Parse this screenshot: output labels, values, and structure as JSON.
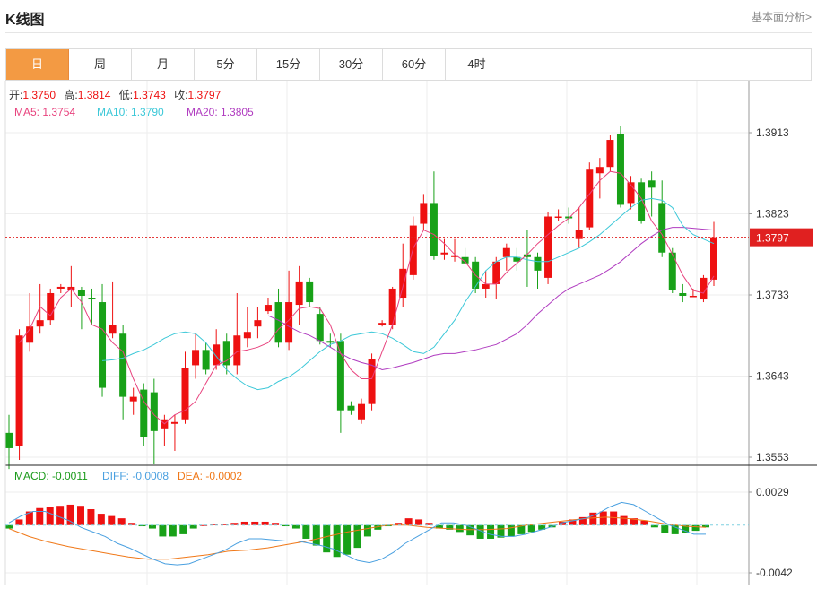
{
  "header": {
    "title": "K线图",
    "link": "基本面分析>"
  },
  "tabs": [
    "日",
    "周",
    "月",
    "5分",
    "15分",
    "30分",
    "60分",
    "4时"
  ],
  "active_tab": 0,
  "colors": {
    "up": "#ee1111",
    "down": "#18a118",
    "ma5": "#e8437e",
    "ma10": "#3cc8d8",
    "ma20": "#b03cc0",
    "macd": "#1a9a1a",
    "diff": "#4aa0e0",
    "dea": "#f07818",
    "price_line": "#e02020"
  },
  "chart_data": [
    {
      "type": "candlestick",
      "ohlc_labels": {
        "open_label": "开:",
        "open": "1.3750",
        "high_label": "高:",
        "high": "1.3814",
        "low_label": "低:",
        "low": "1.3743",
        "close_label": "收:",
        "close": "1.3797"
      },
      "ma_labels": {
        "ma5": "MA5: 1.3754",
        "ma10": "MA10: 1.3790",
        "ma20": "MA20: 1.3805"
      },
      "y_ticks": [
        "1.3913",
        "1.3823",
        "1.3733",
        "1.3643",
        "1.3553"
      ],
      "last_price": "1.3797",
      "ylim": [
        1.3553,
        1.3913
      ],
      "candles": [
        [
          1.358,
          1.3563,
          1.36,
          1.354
        ],
        [
          1.3565,
          1.3688,
          1.3695,
          1.355
        ],
        [
          1.368,
          1.3698,
          1.3735,
          1.367
        ],
        [
          1.3698,
          1.3705,
          1.3745,
          1.369
        ],
        [
          1.3705,
          1.3735,
          1.374,
          1.37
        ],
        [
          1.374,
          1.3742,
          1.3745,
          1.3735
        ],
        [
          1.3738,
          1.3742,
          1.3765,
          1.372
        ],
        [
          1.3738,
          1.3732,
          1.3742,
          1.3695
        ],
        [
          1.373,
          1.3728,
          1.374,
          1.37
        ],
        [
          1.3725,
          1.363,
          1.3745,
          1.362
        ],
        [
          1.369,
          1.37,
          1.3748,
          1.3685
        ],
        [
          1.369,
          1.362,
          1.37,
          1.3595
        ],
        [
          1.3615,
          1.362,
          1.363,
          1.36
        ],
        [
          1.3628,
          1.3575,
          1.3635,
          1.3565
        ],
        [
          1.3625,
          1.3582,
          1.364,
          1.3545
        ],
        [
          1.3585,
          1.3595,
          1.36,
          1.3565
        ],
        [
          1.359,
          1.3592,
          1.36,
          1.356
        ],
        [
          1.3595,
          1.3652,
          1.367,
          1.359
        ],
        [
          1.3655,
          1.3672,
          1.369,
          1.364
        ],
        [
          1.3672,
          1.365,
          1.368,
          1.3645
        ],
        [
          1.3655,
          1.3678,
          1.3695,
          1.365
        ],
        [
          1.3682,
          1.3655,
          1.369,
          1.3645
        ],
        [
          1.3655,
          1.3688,
          1.3735,
          1.3645
        ],
        [
          1.3685,
          1.3692,
          1.372,
          1.3675
        ],
        [
          1.3698,
          1.3705,
          1.372,
          1.3685
        ],
        [
          1.3715,
          1.3722,
          1.373,
          1.3712
        ],
        [
          1.3725,
          1.368,
          1.374,
          1.3675
        ],
        [
          1.368,
          1.3725,
          1.376,
          1.3672
        ],
        [
          1.3722,
          1.3748,
          1.3765,
          1.37
        ],
        [
          1.3748,
          1.3725,
          1.3752,
          1.372
        ],
        [
          1.3712,
          1.3682,
          1.372,
          1.3678
        ],
        [
          1.3682,
          1.368,
          1.369,
          1.3675
        ],
        [
          1.3682,
          1.3605,
          1.369,
          1.358
        ],
        [
          1.361,
          1.3605,
          1.3615,
          1.36
        ],
        [
          1.3595,
          1.3612,
          1.3618,
          1.359
        ],
        [
          1.3612,
          1.3662,
          1.3668,
          1.3605
        ],
        [
          1.37,
          1.3702,
          1.3705,
          1.3698
        ],
        [
          1.37,
          1.374,
          1.3742,
          1.3695
        ],
        [
          1.373,
          1.3762,
          1.379,
          1.372
        ],
        [
          1.3755,
          1.381,
          1.382,
          1.375
        ],
        [
          1.3812,
          1.3835,
          1.3845,
          1.3805
        ],
        [
          1.3835,
          1.3776,
          1.387,
          1.3772
        ],
        [
          1.3778,
          1.378,
          1.3795,
          1.3772
        ],
        [
          1.3775,
          1.3777,
          1.3795,
          1.377
        ],
        [
          1.3775,
          1.3768,
          1.3785,
          1.377
        ],
        [
          1.377,
          1.374,
          1.3775,
          1.3735
        ],
        [
          1.374,
          1.3745,
          1.376,
          1.373
        ],
        [
          1.3745,
          1.377,
          1.3775,
          1.3728
        ],
        [
          1.3775,
          1.3785,
          1.379,
          1.376
        ],
        [
          1.3775,
          1.377,
          1.3785,
          1.376
        ],
        [
          1.3778,
          1.3775,
          1.3805,
          1.3742
        ],
        [
          1.3775,
          1.376,
          1.378,
          1.374
        ],
        [
          1.3752,
          1.382,
          1.3825,
          1.3745
        ],
        [
          1.382,
          1.382,
          1.3828,
          1.3815
        ],
        [
          1.382,
          1.3818,
          1.383,
          1.3812
        ],
        [
          1.3795,
          1.3805,
          1.383,
          1.3785
        ],
        [
          1.3808,
          1.3872,
          1.388,
          1.3805
        ],
        [
          1.3868,
          1.3875,
          1.3885,
          1.384
        ],
        [
          1.3875,
          1.3905,
          1.391,
          1.387
        ],
        [
          1.3912,
          1.3833,
          1.392,
          1.383
        ],
        [
          1.3835,
          1.3858,
          1.3865,
          1.3828
        ],
        [
          1.3858,
          1.3815,
          1.3862,
          1.3812
        ],
        [
          1.386,
          1.3852,
          1.387,
          1.382
        ],
        [
          1.3835,
          1.378,
          1.386,
          1.3775
        ],
        [
          1.378,
          1.3738,
          1.3785,
          1.3735
        ],
        [
          1.3735,
          1.3732,
          1.3745,
          1.3725
        ],
        [
          1.3732,
          1.3732,
          1.374,
          1.3732
        ],
        [
          1.3728,
          1.3752,
          1.3755,
          1.3725
        ],
        [
          1.375,
          1.3797,
          1.3814,
          1.3743
        ]
      ],
      "ma5": [
        1.368,
        1.3695,
        1.372,
        1.371,
        1.373,
        1.374,
        1.3725,
        1.37,
        1.3695,
        1.368,
        1.367,
        1.364,
        1.3615,
        1.36,
        1.359,
        1.36,
        1.3605,
        1.3615,
        1.3635,
        1.3655,
        1.366,
        1.367,
        1.3672,
        1.3675,
        1.368,
        1.3695,
        1.3705,
        1.3718,
        1.372,
        1.3718,
        1.37,
        1.3668,
        1.365,
        1.364,
        1.364,
        1.367,
        1.37,
        1.3742,
        1.3785,
        1.3805,
        1.38,
        1.379,
        1.3778,
        1.377,
        1.3755,
        1.3745,
        1.3745,
        1.3758,
        1.3768,
        1.3778,
        1.379,
        1.38,
        1.381,
        1.3818,
        1.383,
        1.3845,
        1.386,
        1.387,
        1.3868,
        1.3855,
        1.384,
        1.3815,
        1.38,
        1.3778,
        1.3755,
        1.3738,
        1.3735,
        1.3754
      ],
      "ma10": [
        1.366,
        1.3661,
        1.3663,
        1.3668,
        1.3672,
        1.3678,
        1.3685,
        1.369,
        1.3692,
        1.369,
        1.368,
        1.3665,
        1.365,
        1.364,
        1.3632,
        1.3628,
        1.363,
        1.3637,
        1.3642,
        1.365,
        1.366,
        1.367,
        1.3678,
        1.3682,
        1.3688,
        1.369,
        1.3692,
        1.369,
        1.3685,
        1.3678,
        1.367,
        1.3668,
        1.3675,
        1.369,
        1.3705,
        1.3725,
        1.3742,
        1.376,
        1.377,
        1.3775,
        1.3775,
        1.3772,
        1.377,
        1.377,
        1.3775,
        1.378,
        1.3785,
        1.3792,
        1.38,
        1.381,
        1.382,
        1.383,
        1.3838,
        1.384,
        1.3838,
        1.383,
        1.381,
        1.38,
        1.3795,
        1.379
      ],
      "ma20": [
        1.371,
        1.3705,
        1.3698,
        1.3692,
        1.3688,
        1.3682,
        1.3675,
        1.3668,
        1.3662,
        1.3658,
        1.3655,
        1.365,
        1.3652,
        1.3655,
        1.3658,
        1.3662,
        1.3666,
        1.3668,
        1.3668,
        1.367,
        1.3672,
        1.3675,
        1.3678,
        1.3684,
        1.369,
        1.37,
        1.3712,
        1.3722,
        1.3732,
        1.374,
        1.3745,
        1.375,
        1.3755,
        1.3762,
        1.377,
        1.378,
        1.379,
        1.3798,
        1.3805,
        1.3808,
        1.3808,
        1.3807,
        1.3806,
        1.3805
      ]
    },
    {
      "type": "bar",
      "labels": {
        "macd": "MACD: -0.0011",
        "diff": "DIFF: -0.0008",
        "dea": "DEA: -0.0002"
      },
      "y_ticks": [
        "0.0029",
        "-0.0042"
      ],
      "ylim": [
        -0.0042,
        0.0029
      ],
      "macd": [
        -0.0003,
        0.0005,
        0.0012,
        0.0015,
        0.0016,
        0.0017,
        0.0018,
        0.0017,
        0.0014,
        0.001,
        0.0008,
        0.0006,
        0.0002,
        -0.0001,
        -0.0003,
        -0.001,
        -0.001,
        -0.0008,
        -0.0003,
        0,
        0.0001,
        0.0001,
        0.0002,
        0.0003,
        0.0003,
        0.0003,
        0.0002,
        -0.0001,
        -0.0003,
        -0.0012,
        -0.0018,
        -0.0024,
        -0.0028,
        -0.0026,
        -0.002,
        -0.001,
        -0.0004,
        -0.0001,
        0.0002,
        0.0006,
        0.0005,
        0.0002,
        -0.0003,
        -0.0004,
        -0.0006,
        -0.0009,
        -0.0012,
        -0.0012,
        -0.0011,
        -0.001,
        -0.0008,
        -0.0006,
        -0.0004,
        -0.0002,
        0.0003,
        0.0005,
        0.0007,
        0.0011,
        0.0012,
        0.0012,
        0.0008,
        0.0006,
        0.0004,
        -0.0002,
        -0.0007,
        -0.0008,
        -0.0007,
        -0.0005,
        -0.0002
      ],
      "diff": [
        0.0002,
        0.0008,
        0.0012,
        0.0012,
        0.0008,
        0.0004,
        -0.0002,
        -0.0006,
        -0.001,
        -0.0016,
        -0.002,
        -0.0025,
        -0.003,
        -0.0034,
        -0.0035,
        -0.0034,
        -0.003,
        -0.0026,
        -0.0022,
        -0.0016,
        -0.0012,
        -0.0012,
        -0.0013,
        -0.0014,
        -0.0014,
        -0.0016,
        -0.0018,
        -0.0021,
        -0.0026,
        -0.0031,
        -0.0033,
        -0.003,
        -0.0024,
        -0.0016,
        -0.001,
        -0.0004,
        0.0002,
        0.0002,
        0,
        -0.0004,
        -0.0008,
        -0.001,
        -0.001,
        -0.0008,
        -0.0005,
        -0.0002,
        0.0002,
        0.0004,
        0.0006,
        0.001,
        0.0016,
        0.002,
        0.0018,
        0.0012,
        0.0006,
        0,
        -0.0004,
        -0.0008,
        -0.0008
      ],
      "dea": [
        -0.0003,
        -0.001,
        -0.0015,
        -0.0019,
        -0.0022,
        -0.0025,
        -0.0028,
        -0.003,
        -0.003,
        -0.0028,
        -0.0026,
        -0.0023,
        -0.0022,
        -0.002,
        -0.0017,
        -0.0014,
        -0.001,
        -0.0006,
        -0.0003,
        0,
        0,
        -0.0002,
        -0.0003,
        -0.0004,
        -0.0004,
        -0.0003,
        0,
        0.0002,
        0.0004,
        0.0006,
        0.0007,
        0.0006,
        0.0004,
        0.0001,
        -0.0001,
        -0.0002
      ]
    }
  ]
}
